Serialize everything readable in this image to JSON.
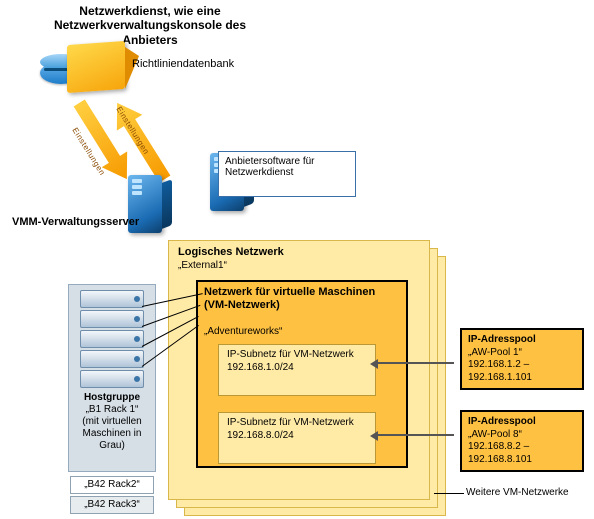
{
  "title": "Netzwerkdienst, wie eine Netzwerkverwaltungskonsole des Anbieters",
  "policy_db_label": "Richtliniendatenbank",
  "arrow_down_text": "Einstellungen",
  "arrow_up_text": "Einstellungen",
  "vmm_server_label": "VMM-Verwaltungsserver",
  "provider_box": "Anbietersoftware für Netzwerkdienst",
  "logical_network": {
    "title": "Logisches Netzwerk",
    "name": "„External1“"
  },
  "vm_network": {
    "title": "Netzwerk für virtuelle Maschinen (VM-Netzwerk)",
    "name": "„Adventureworks“"
  },
  "subnets": [
    {
      "label": "IP-Subnetz für VM-Netzwerk",
      "cidr": "192.168.1.0/24"
    },
    {
      "label": "IP-Subnetz für VM-Netzwerk",
      "cidr": "192.168.8.0/24"
    }
  ],
  "pools": [
    {
      "heading": "IP-Adresspool",
      "name": "„AW-Pool 1“",
      "range": "192.168.1.2 – 192.168.1.101"
    },
    {
      "heading": "IP-Adresspool",
      "name": "„AW-Pool 8“",
      "range": "192.168.8.2 – 192.168.8.101"
    }
  ],
  "host_group": {
    "heading": "Hostgruppe",
    "name": "„B1 Rack 1“",
    "note": "(mit virtuellen Maschinen in Grau)",
    "others": [
      "„B42 Rack2“",
      "„B42 Rack3“"
    ]
  },
  "more_vm_label": "Weitere VM-Netzwerke"
}
